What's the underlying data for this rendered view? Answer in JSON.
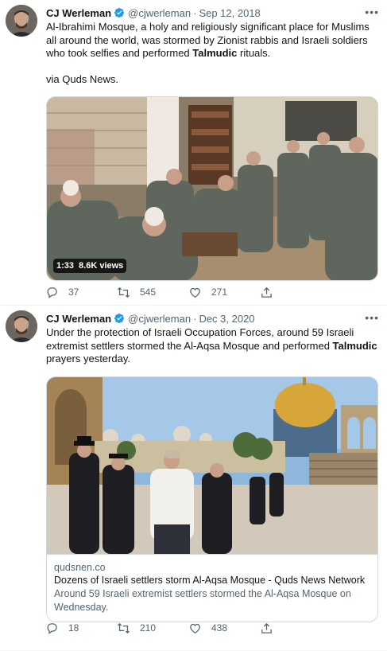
{
  "tweets": [
    {
      "author_name": "CJ Werleman",
      "handle": "@cjwerleman",
      "separator": "·",
      "date": "Sep 12, 2018",
      "text_before_bold": "Al-Ibrahimi Mosque, a holy and religiously significant place for Muslims all around the world, was stormed by Zionist rabbis and Israeli soldiers who took selfies and performed ",
      "text_bold": "Talmudic",
      "text_after_bold": " rituals.",
      "text_second_paragraph": "via Quds News.",
      "video": {
        "duration": "1:33",
        "views": "8.6K views"
      },
      "replies": "37",
      "retweets": "545",
      "likes": "271"
    },
    {
      "author_name": "CJ Werleman",
      "handle": "@cjwerleman",
      "separator": "·",
      "date": "Dec 3, 2020",
      "text_before_bold": "Under the protection of Israeli Occupation Forces, around 59 Israeli extremist settlers stormed the Al-Aqsa Mosque and performed ",
      "text_bold": "Talmudic",
      "text_after_bold": " prayers yesterday.",
      "card": {
        "domain": "qudsnen.co",
        "title": "Dozens of Israeli settlers storm Al-Aqsa Mosque - Quds News Network",
        "description": "Around 59 Israeli extremist settlers stormed the Al-Aqsa Mosque on Wednesday."
      },
      "replies": "18",
      "retweets": "210",
      "likes": "438"
    }
  ],
  "colors": {
    "verified": "#1d9bf0",
    "secondary_text": "#536471",
    "border": "#cfd9de"
  },
  "icons": [
    "verified-badge-icon",
    "more-icon",
    "reply-icon",
    "retweet-icon",
    "like-icon",
    "share-icon"
  ]
}
